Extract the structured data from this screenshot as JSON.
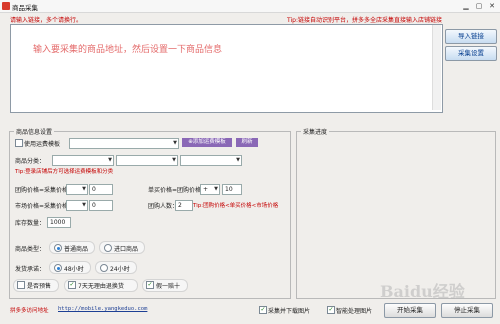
{
  "window": {
    "title": "商品采集"
  },
  "hints": {
    "left": "请输入链接，多个请换行。",
    "right": "Tip:链接自动识别平台，拼多多全店采集直接输入店铺链接"
  },
  "url_input": {
    "placeholder": "输入要采集的商品地址，然后设置一下商品信息"
  },
  "side_buttons": {
    "import": "导入链接",
    "settings": "采集设置"
  },
  "product_settings": {
    "legend": "商品信息设置",
    "shipping_template_label": "使用运费模板",
    "add_template_btn": "添加运费模板",
    "refresh_btn": "刷新",
    "category_label": "商品分类：",
    "shipping_tip": "Tip:登录店铺后方可选择运费模板和分类",
    "group_price_label": "团购价格=采集价格",
    "group_price_value": "0",
    "single_price_label": "单买价格=团购价格",
    "single_price_op": "+",
    "single_price_value": "10",
    "market_price_label": "市场价格=采集价格",
    "market_price_value": "0",
    "group_size_label": "团购人数：",
    "group_size_value": "2",
    "price_tip": "Tip:团购价格<单买价格<市场价格",
    "stock_label": "库存数量：",
    "stock_value": "1000",
    "product_type_label": "商品类型：",
    "product_type_options": [
      "普通商品",
      "进口商品"
    ],
    "ship_promise_label": "发货承诺：",
    "ship_promise_options": [
      "48小时",
      "24小时"
    ],
    "presale_label": "是否预售",
    "return_label": "7天无理由退换货",
    "fake_label": "假一赔十"
  },
  "progress": {
    "legend": "采集进度"
  },
  "footer": {
    "visit_label": "拼多多访问地址",
    "visit_url": "http://mobile.yangkeduo.com",
    "download_images_label": "采集并下载图片",
    "smart_images_label": "智能处理图片",
    "start_btn": "开始采集",
    "stop_btn": "停止采集"
  },
  "watermark": "Baidu经验",
  "colors": {
    "hint_red": "#c40000",
    "accent_purple": "#8a68b6",
    "placeholder_red": "#e46b6b"
  }
}
